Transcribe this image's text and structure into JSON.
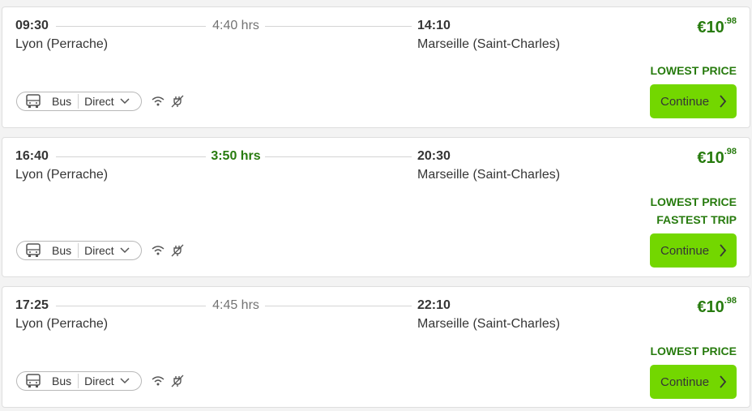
{
  "results": [
    {
      "departure_time": "09:30",
      "departure_station": "Lyon (Perrache)",
      "duration": "4:40 hrs",
      "duration_fast": false,
      "arrival_time": "14:10",
      "arrival_station": "Marseille (Saint-Charles)",
      "price_main": "€10",
      "price_cents": ".98",
      "tags": [
        "LOWEST PRICE"
      ],
      "mode": "Bus",
      "connection": "Direct",
      "amenities": [
        "wifi-icon",
        "power-plug-icon"
      ],
      "continue_label": "Continue"
    },
    {
      "departure_time": "16:40",
      "departure_station": "Lyon (Perrache)",
      "duration": "3:50 hrs",
      "duration_fast": true,
      "arrival_time": "20:30",
      "arrival_station": "Marseille (Saint-Charles)",
      "price_main": "€10",
      "price_cents": ".98",
      "tags": [
        "LOWEST PRICE",
        "FASTEST TRIP"
      ],
      "mode": "Bus",
      "connection": "Direct",
      "amenities": [
        "wifi-icon",
        "power-plug-icon"
      ],
      "continue_label": "Continue"
    },
    {
      "departure_time": "17:25",
      "departure_station": "Lyon (Perrache)",
      "duration": "4:45 hrs",
      "duration_fast": false,
      "arrival_time": "22:10",
      "arrival_station": "Marseille (Saint-Charles)",
      "price_main": "€10",
      "price_cents": ".98",
      "tags": [
        "LOWEST PRICE"
      ],
      "mode": "Bus",
      "connection": "Direct",
      "amenities": [
        "wifi-icon",
        "power-plug-icon"
      ],
      "continue_label": "Continue"
    }
  ],
  "colors": {
    "accent_green": "#277b0e",
    "button_green": "#73d700",
    "text": "#353535",
    "muted": "#737373"
  }
}
